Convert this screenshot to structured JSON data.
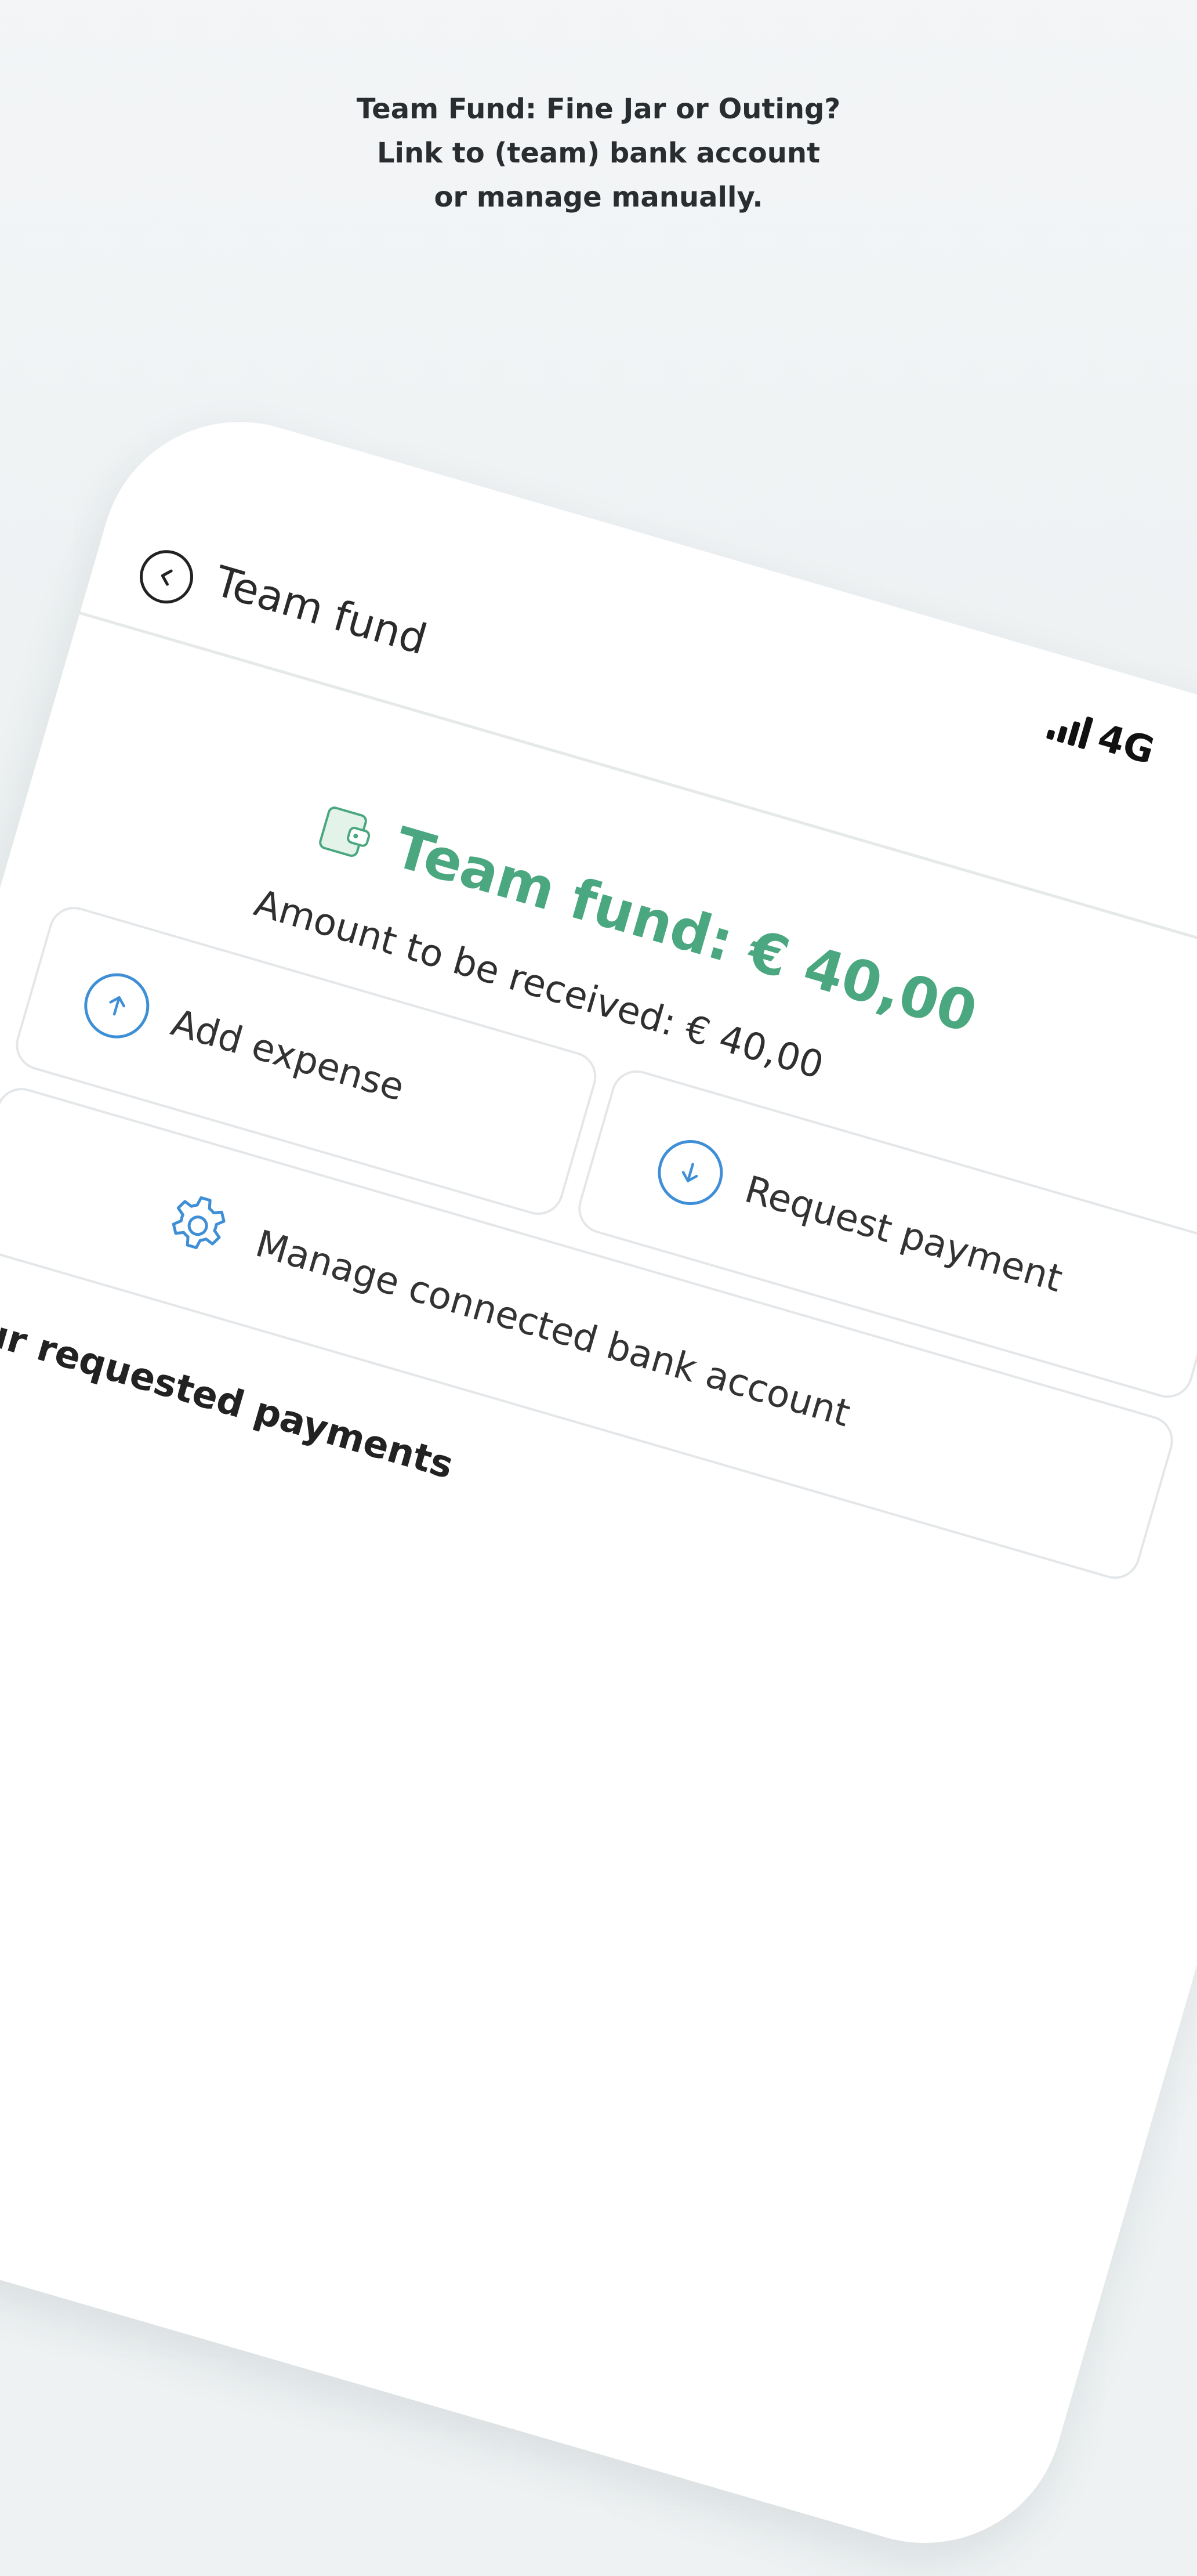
{
  "promo": {
    "line1": "Team Fund: Fine Jar or Outing?",
    "line2": "Link to (team) bank account",
    "line3": "or manage manually."
  },
  "status_bar": {
    "network": "4G",
    "signal_level": 4
  },
  "nav": {
    "back_icon": "chevron-left-circle-icon",
    "title": "Team fund"
  },
  "fund": {
    "icon": "wallet-icon",
    "amount_text": "Team fund: € 40,00",
    "received_text": "Amount to be received: € 40,00"
  },
  "actions": {
    "add_expense": {
      "icon": "arrow-up-circle-icon",
      "label": "Add expense"
    },
    "request_payment": {
      "icon": "arrow-down-circle-icon",
      "label": "Request payment"
    },
    "manage_bank": {
      "icon": "gear-icon",
      "label": "Manage connected bank account"
    }
  },
  "section": {
    "requested_title": "Your requested payments"
  },
  "colors": {
    "accent_green": "#4aa77f",
    "accent_blue": "#3f8fd6",
    "text_dark": "#2a2d30"
  }
}
